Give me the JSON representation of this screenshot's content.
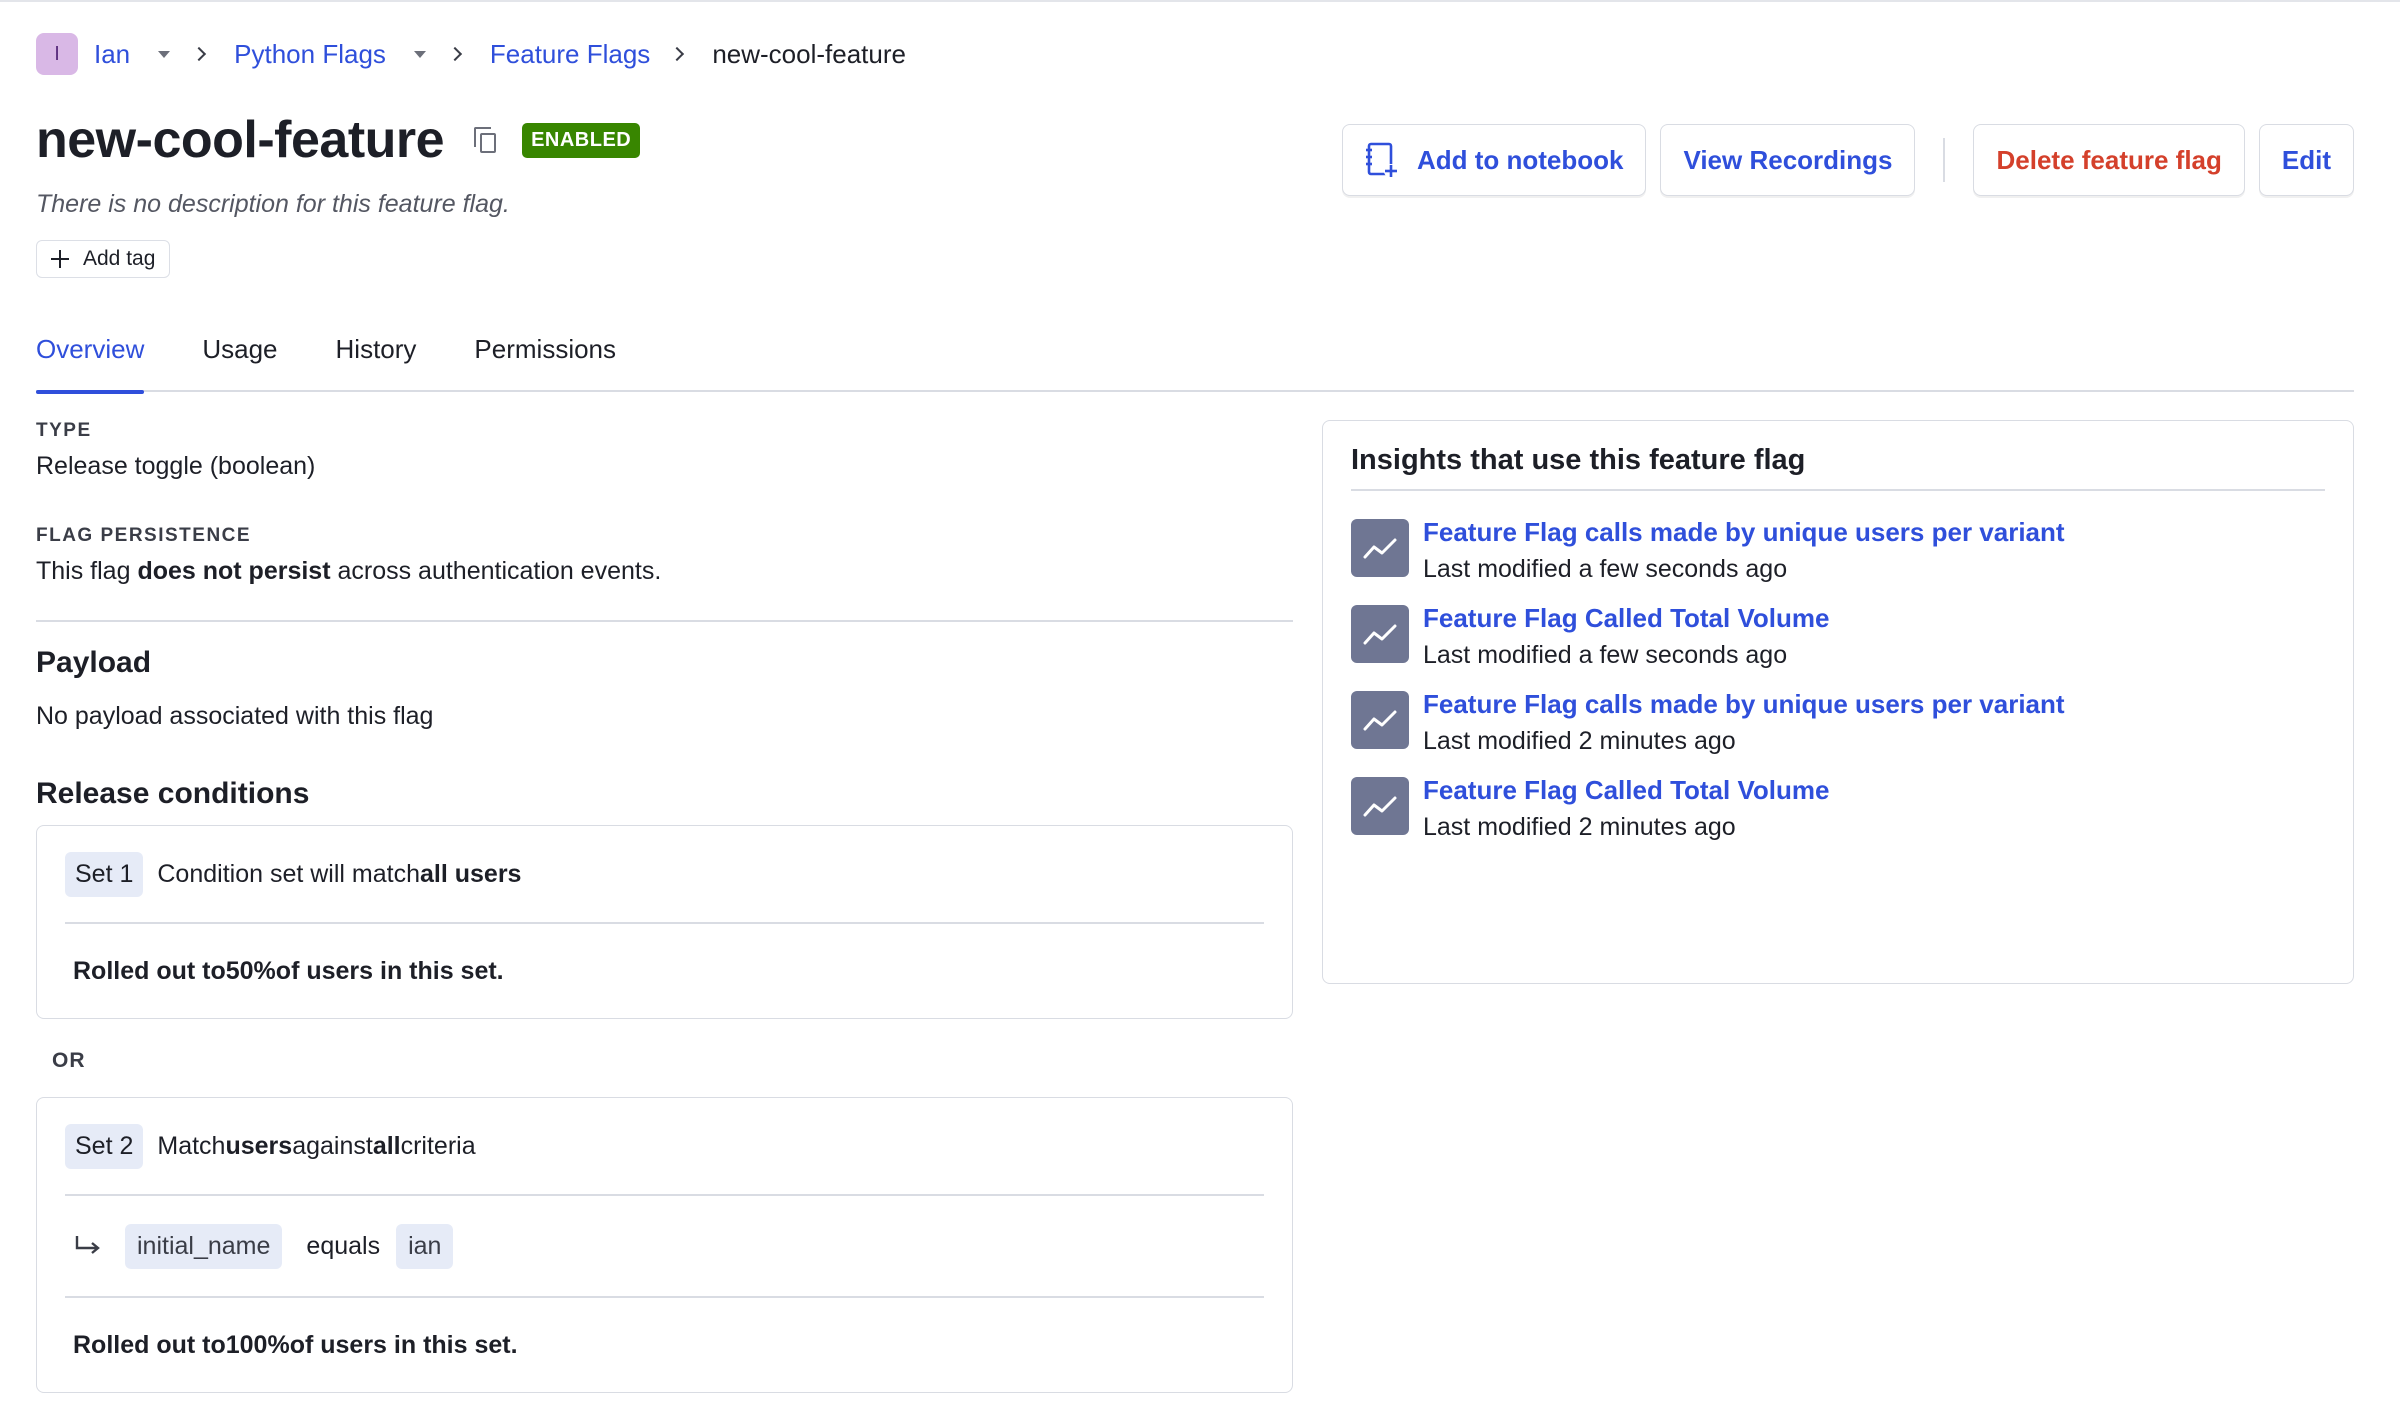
{
  "breadcrumb": {
    "avatar_initial": "I",
    "user": "Ian",
    "project": "Python Flags",
    "section": "Feature Flags",
    "current": "new-cool-feature"
  },
  "flag": {
    "title": "new-cool-feature",
    "status": "ENABLED",
    "description": "There is no description for this feature flag.",
    "add_tag_label": "Add tag"
  },
  "actions": {
    "add_notebook": "Add to notebook",
    "view_recordings": "View Recordings",
    "delete": "Delete feature flag",
    "edit": "Edit"
  },
  "tabs": [
    {
      "label": "Overview",
      "active": true
    },
    {
      "label": "Usage",
      "active": false
    },
    {
      "label": "History",
      "active": false
    },
    {
      "label": "Permissions",
      "active": false
    }
  ],
  "overview": {
    "type_label": "TYPE",
    "type_value": "Release toggle (boolean)",
    "persistence_label": "FLAG PERSISTENCE",
    "persistence_pre": "This flag ",
    "persistence_bold": "does not persist",
    "persistence_post": " across authentication events.",
    "payload_title": "Payload",
    "payload_value": "No payload associated with this flag",
    "release_title": "Release conditions",
    "or_label": "OR"
  },
  "sets": [
    {
      "tag": "Set 1",
      "desc_pre": "Condition set will match ",
      "desc_bold": "all users",
      "rollout_pre": "Rolled out to ",
      "rollout_pct": "50%",
      "rollout_post": " of users in this set."
    },
    {
      "tag": "Set 2",
      "desc_pre": "Match ",
      "desc_bold1": "users",
      "desc_mid": " against ",
      "desc_bold2": "all",
      "desc_post": " criteria",
      "criteria_property": "initial_name",
      "criteria_operator": "equals",
      "criteria_value": "ian",
      "rollout_pre": "Rolled out to ",
      "rollout_pct": "100%",
      "rollout_post": " of users in this set."
    }
  ],
  "insights": {
    "title": "Insights that use this feature flag",
    "items": [
      {
        "name": "Feature Flag calls made by unique users per variant",
        "meta": "Last modified a few seconds ago"
      },
      {
        "name": "Feature Flag Called Total Volume",
        "meta": "Last modified a few seconds ago"
      },
      {
        "name": "Feature Flag calls made by unique users per variant",
        "meta": "Last modified 2 minutes ago"
      },
      {
        "name": "Feature Flag Called Total Volume",
        "meta": "Last modified 2 minutes ago"
      }
    ]
  },
  "colors": {
    "accent": "#2f4fdb",
    "danger": "#d4402b",
    "enabled": "#388600"
  }
}
